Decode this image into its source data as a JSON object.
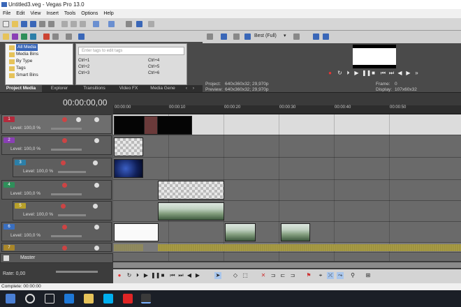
{
  "window": {
    "title": "Untitled3.veg - Vegas Pro 13.0"
  },
  "menu": [
    "File",
    "Edit",
    "View",
    "Insert",
    "Tools",
    "Options",
    "Help"
  ],
  "media_tree": [
    "All Media",
    "Media Bins",
    "By Type",
    "Tags",
    "Smart Bins"
  ],
  "tags": {
    "search_placeholder": "Enter tags to edit tags",
    "shortcuts": [
      "Ctrl+1",
      "Ctrl+4",
      "Ctrl+2",
      "Ctrl+5",
      "Ctrl+3",
      "Ctrl+6"
    ]
  },
  "panel_tabs": [
    "Project Media",
    "Explorer",
    "Transitions",
    "Video FX",
    "Media Gene"
  ],
  "preview": {
    "quality": "Best (Full)",
    "project_label": "Project:",
    "project_value": "640x360x32; 29,970p",
    "preview_label": "Preview:",
    "preview_value": "640x360x32; 29,970p",
    "frame_label": "Frame:",
    "frame_value": "0",
    "display_label": "Display:",
    "display_value": "107x60x32"
  },
  "timeline": {
    "timecode": "00:00:00,00",
    "ruler": [
      "00:00:00",
      "00:00:10",
      "00:00:20",
      "00:00:30",
      "00:00:40",
      "00:00:50"
    ]
  },
  "tracks": [
    {
      "num": "1",
      "level": "Level: 100,0 %",
      "color": "#b52a3c"
    },
    {
      "num": "2",
      "level": "Level: 100,0 %",
      "color": "#8a3fb5"
    },
    {
      "num": "3",
      "level": "Level: 100,0 %",
      "color": "#2c7fa8"
    },
    {
      "num": "4",
      "level": "Level: 100,0 %",
      "color": "#2f8f5a"
    },
    {
      "num": "5",
      "level": "Level: 100,0 %",
      "color": "#b8a02a"
    },
    {
      "num": "6",
      "level": "Level: 100,0 %",
      "color": "#3a6fc0"
    },
    {
      "num": "7",
      "level": "",
      "color": "#a8862a"
    }
  ],
  "master": {
    "label": "Master"
  },
  "rate": {
    "label": "Rate: 0,00"
  },
  "status": {
    "text": "Complete: 00:00:00"
  },
  "colors": {
    "accent": "#3a67b8",
    "selected_lane": "#dcdcdc",
    "audio_wave": "#b5a84a"
  }
}
